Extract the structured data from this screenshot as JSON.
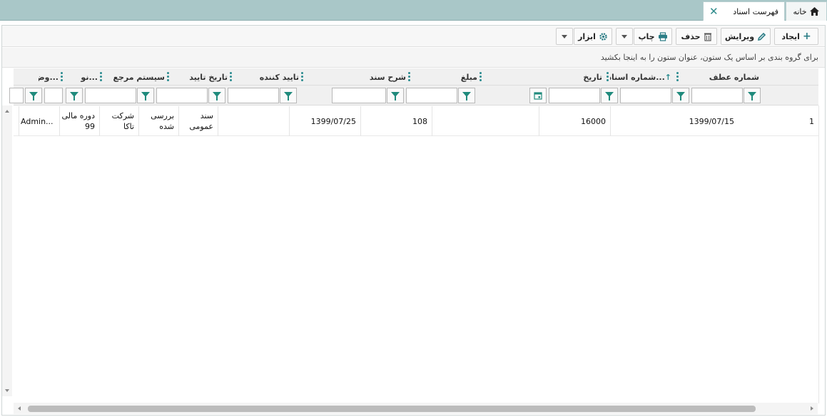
{
  "tabs": {
    "home_label": "خانه",
    "docs_label": "فهرست اسناد",
    "close_glyph": "✕",
    "home_icon": "home-icon"
  },
  "toolbar": {
    "create_label": "ایجاد",
    "edit_label": "ویرایش",
    "delete_label": "حذف",
    "print_label": "چاپ",
    "tools_label": "ابزار"
  },
  "group_hint": "برای گروه بندی بر اساس یک ستون، عنوان ستون را به اینجا بکشید",
  "columns": [
    "شماره عطف",
    "شماره اسناد...",
    "تاریخ",
    "مبلغ",
    "شرح سند",
    "تایید کننده",
    "تاریخ تایید",
    "سیستم مرجع",
    "نو...",
    "وض..."
  ],
  "rows": [
    {
      "ref_no": "1",
      "doc_no": "1399/07/15",
      "date": "16000",
      "amount": "",
      "description": "108",
      "approver": "1399/07/25",
      "approve_date": "",
      "type": "سند عمومی",
      "status": "بررسی شده",
      "company": "شرکت تاکا",
      "period": "دوره مالی 99",
      "user": "Admin..."
    }
  ],
  "colors": {
    "tabbar": "#a9c7c8",
    "accent": "#2b8b8f",
    "funnel": "#1f8a7c"
  }
}
